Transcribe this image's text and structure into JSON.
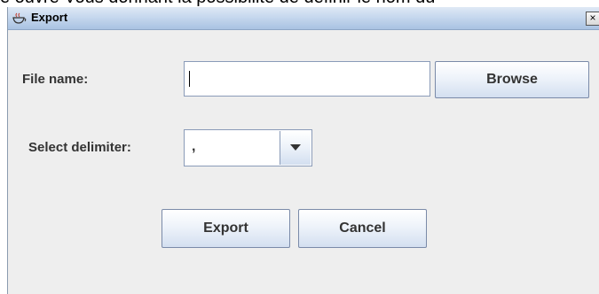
{
  "background_text": "e ouvre  Vous donnant la possibilité de définir le nom du",
  "window": {
    "title": "Export",
    "close_glyph": "×"
  },
  "form": {
    "file_name_label": "File name:",
    "file_name_value": "",
    "browse_label": "Browse",
    "delimiter_label": "Select delimiter:",
    "delimiter_value": ","
  },
  "actions": {
    "export_label": "Export",
    "cancel_label": "Cancel"
  },
  "icons": {
    "app": "java-cup-icon",
    "close": "close-icon",
    "dropdown": "chevron-down-icon"
  }
}
